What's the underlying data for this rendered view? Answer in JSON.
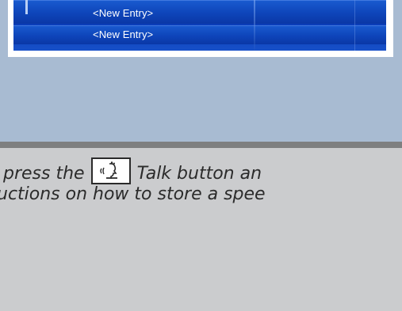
{
  "screen": {
    "entries": [
      "<New Entry>",
      "<New Entry>"
    ]
  },
  "instructions": {
    "line1_before": "press the",
    "line1_after": "Talk button an",
    "line2": "uctions on how to store a spee",
    "talk_icon": "voice-talk-icon"
  },
  "colors": {
    "screen_blue": "#0a3db8",
    "top_band": "#a8bbd2",
    "page_bg": "#cbccce",
    "divider": "#7e7f80"
  }
}
